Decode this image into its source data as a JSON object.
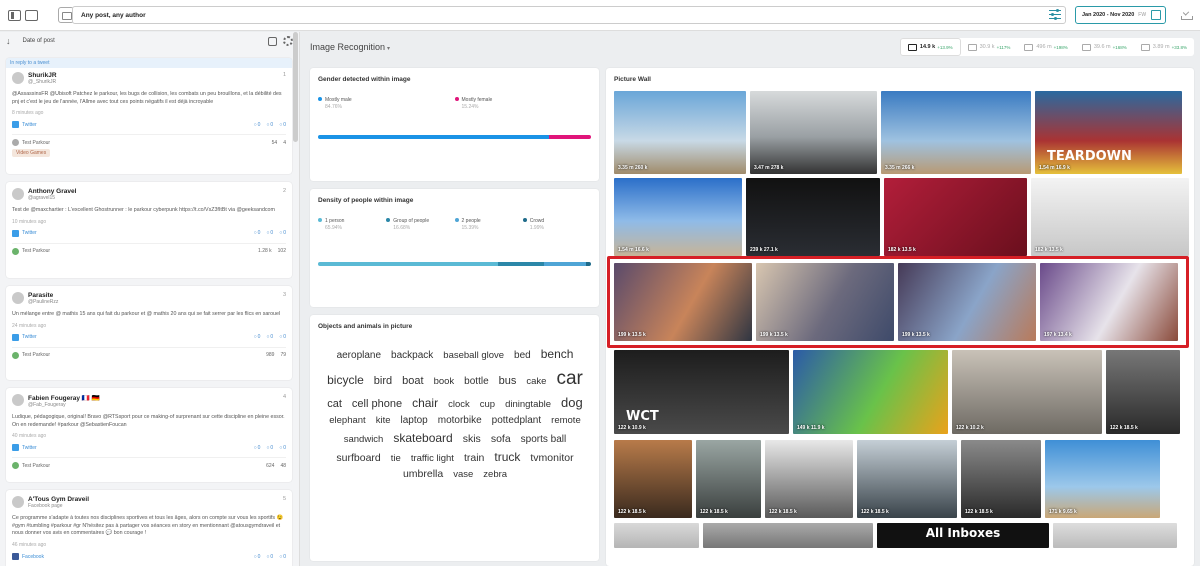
{
  "search": {
    "value": "Any post, any author"
  },
  "date_range": {
    "label": "Jan 2020 - Nov 2020",
    "hint": "FW"
  },
  "sidebar": {
    "sort_label": "Date of post"
  },
  "posts": [
    {
      "reply_note": "In reply to a tweet",
      "name": "ShurikJR",
      "handle": "@_ShurikJR",
      "num": "1",
      "text": "@AssassinsFR @Ubisoft Patchez le parkour, les bugs de collision, les combats un peu brouillons, et la débilité des pnj et c'est le jeu de l'année, l'Allme avec tout ces points négatifs il est déjà incroyable",
      "time": "8 minutes ago",
      "network": "Twitter",
      "eng": [
        "0",
        "0",
        "0"
      ],
      "project": "Test Parkour",
      "shares": "54",
      "reach": "4",
      "tag": "Video Games"
    },
    {
      "name": "Anthony Gravel",
      "handle": "@agravel15",
      "num": "2",
      "text": "Test de @maxchartier : L'excellent Ghostrunner : le parkour cyberpunk https://t.co/VsZ3fItBt via @geeksandcom",
      "time": "10 minutes ago",
      "network": "Twitter",
      "eng": [
        "0",
        "0",
        "0"
      ],
      "project": "Test Parkour",
      "shares": "1.28 k",
      "reach": "102"
    },
    {
      "name": "Parasite",
      "handle": "@PaulineRzz",
      "num": "3",
      "text": "Un mélange entre @ mathis 15 ans qui fait du parkour et @ mathis 20 ans qui se fait serrer par les flics en sarouel",
      "time": "24 minutes ago",
      "network": "Twitter",
      "eng": [
        "0",
        "0",
        "0"
      ],
      "project": "Test Parkour",
      "shares": "989",
      "reach": "79"
    },
    {
      "name": "Fabien Fougeray 🇫🇷 🇩🇪",
      "handle": "@Fab_Fougeray",
      "num": "4",
      "text": "Ludique, pédagogique, original! Bravo @RTSsport pour ce making-of surprenant sur cette discipline en pleine essor. On en redemande! #parkour @SebastienFoucan",
      "time": "40 minutes ago",
      "network": "Twitter",
      "eng": [
        "0",
        "0",
        "0"
      ],
      "project": "Test Parkour",
      "shares": "624",
      "reach": "48"
    },
    {
      "name": "A'Tous Gym Draveil",
      "handle": "Facebook page",
      "num": "5",
      "text": "Ce programme s'adapte à toutes nos disciplines sportives et tous les âges, alors on compte sur vous les sportifs 😉 #gym #tumbling #parkour #gr N'hésitez pas à partager vos séances en story en mentionnant @atousgymdraveil et nous donner vos avis en commentaires 💬 bon courage !",
      "time": "46 minutes ago",
      "network": "Facebook",
      "eng": [
        "0",
        "0",
        "0"
      ]
    }
  ],
  "main": {
    "title": "Image Recognition"
  },
  "metrics": [
    {
      "value": "14.9 k",
      "trend": "+13.9%",
      "icon": "comment-icon"
    },
    {
      "value": "30.9 k",
      "trend": "+117%",
      "icon": "screen-icon"
    },
    {
      "value": "496 m",
      "trend": "+198%",
      "icon": "link-icon"
    },
    {
      "value": "39.6 m",
      "trend": "+168%",
      "icon": "user-icon"
    },
    {
      "value": "3.89 m",
      "trend": "+33.8%",
      "icon": "share-icon"
    }
  ],
  "gender": {
    "title": "Gender detected within image",
    "items": [
      {
        "label": "Mostly male",
        "pct": "84.76%",
        "value": 84.76,
        "color": "#1a93e6"
      },
      {
        "label": "Mostly female",
        "pct": "15.24%",
        "value": 15.24,
        "color": "#e0157a"
      }
    ]
  },
  "density": {
    "title": "Density of people within image",
    "items": [
      {
        "label": "1 person",
        "pct": "65.94%",
        "value": 65.94,
        "color": "#5bbad5"
      },
      {
        "label": "Group of people",
        "pct": "16.68%",
        "value": 16.68,
        "color": "#2b87a8"
      },
      {
        "label": "2 people",
        "pct": "15.39%",
        "value": 15.39,
        "color": "#4fa5d6"
      },
      {
        "label": "Crowd",
        "pct": "1.99%",
        "value": 1.99,
        "color": "#1f6b8a"
      }
    ]
  },
  "objects": {
    "title": "Objects and animals in picture",
    "words": [
      {
        "t": "aeroplane",
        "s": 10
      },
      {
        "t": "backpack",
        "s": 10
      },
      {
        "t": "baseball glove",
        "s": 9.5
      },
      {
        "t": "bed",
        "s": 10
      },
      {
        "t": "bench",
        "s": 12
      },
      {
        "t": "bicycle",
        "s": 12
      },
      {
        "t": "bird",
        "s": 11
      },
      {
        "t": "boat",
        "s": 11
      },
      {
        "t": "book",
        "s": 9.5
      },
      {
        "t": "bottle",
        "s": 10
      },
      {
        "t": "bus",
        "s": 11
      },
      {
        "t": "cake",
        "s": 9.5
      },
      {
        "t": "car",
        "s": 19
      },
      {
        "t": "cat",
        "s": 11
      },
      {
        "t": "cell phone",
        "s": 11
      },
      {
        "t": "chair",
        "s": 12
      },
      {
        "t": "clock",
        "s": 9.5
      },
      {
        "t": "cup",
        "s": 9.5
      },
      {
        "t": "diningtable",
        "s": 9.5
      },
      {
        "t": "dog",
        "s": 13
      },
      {
        "t": "elephant",
        "s": 9.5
      },
      {
        "t": "kite",
        "s": 9.5
      },
      {
        "t": "laptop",
        "s": 10
      },
      {
        "t": "motorbike",
        "s": 10
      },
      {
        "t": "pottedplant",
        "s": 10
      },
      {
        "t": "remote",
        "s": 9.5
      },
      {
        "t": "sandwich",
        "s": 9.5
      },
      {
        "t": "skateboard",
        "s": 12
      },
      {
        "t": "skis",
        "s": 10.5
      },
      {
        "t": "sofa",
        "s": 10.5
      },
      {
        "t": "sports ball",
        "s": 10
      },
      {
        "t": "surfboard",
        "s": 10.5
      },
      {
        "t": "tie",
        "s": 9.5
      },
      {
        "t": "traffic light",
        "s": 9.5
      },
      {
        "t": "train",
        "s": 10.5
      },
      {
        "t": "truck",
        "s": 12
      },
      {
        "t": "tvmonitor",
        "s": 10.5
      },
      {
        "t": "umbrella",
        "s": 10.5
      },
      {
        "t": "vase",
        "s": 9.5
      },
      {
        "t": "zebra",
        "s": 9.5
      }
    ]
  },
  "wall": {
    "title": "Picture Wall",
    "rows": [
      [
        {
          "a": "3.35 m",
          "b": "260 k",
          "bg": "linear-gradient(#6aa6d8,#c8d9e6 60%,#a08b6a)"
        },
        {
          "a": "3.47 m",
          "b": "278 k",
          "bg": "linear-gradient(#d7dadb,#9aa0a4 55%,#333)"
        },
        {
          "a": "3.35 m",
          "b": "266 k",
          "bg": "linear-gradient(#3a7bc2,#9fc2e0 60%,#b89a74)"
        },
        {
          "a": "1.54 m",
          "b": "16.9 k",
          "bg": "linear-gradient(#2a6aa0,#a33 60%,#e5c03b)",
          "cap": "TEARDOWN"
        }
      ],
      [
        {
          "a": "1.54 m",
          "b": "16.6 k",
          "bg": "linear-gradient(#2b6fc9,#8fbbe8 55%,#c7b497)"
        },
        {
          "a": "239 k",
          "b": "27.1 k",
          "bg": "linear-gradient(#111,#2a2d33)"
        },
        {
          "a": "182 k",
          "b": "13.5 k",
          "bg": "linear-gradient(135deg,#b21e3a,#6a0f1d)"
        },
        {
          "a": "182 k",
          "b": "13.5 k",
          "bg": "linear-gradient(#f3f3f3,#c7c7c7)"
        }
      ],
      [
        {
          "a": "199 k",
          "b": "13.5 k",
          "bg": "linear-gradient(120deg,#5a4a6b,#c8845a 55%,#2f3542)"
        },
        {
          "a": "199 k",
          "b": "13.5 k",
          "bg": "linear-gradient(120deg,#d8c6b0,#6c6a7d 55%,#3e4a6a)"
        },
        {
          "a": "199 k",
          "b": "13.5 k",
          "bg": "linear-gradient(120deg,#463a57,#8aa4c8 55%,#b97a5a)"
        },
        {
          "a": "197 k",
          "b": "13.4 k",
          "bg": "linear-gradient(120deg,#6a4a8a,#e7e3ea 55%,#8a4a3a)"
        }
      ],
      [
        {
          "a": "122 k",
          "b": "10.9 k",
          "bg": "linear-gradient(#1d1d1d,#4a4a4a)",
          "cap": "WCT"
        },
        {
          "a": "149 k",
          "b": "11.9 k",
          "bg": "linear-gradient(120deg,#2b5aa8,#69c24a 55%,#eaa21b)"
        },
        {
          "a": "122 k",
          "b": "10.2 k",
          "bg": "linear-gradient(#c9c2b8,#6e6a63)"
        },
        {
          "a": "122 k",
          "b": "18.5 k",
          "bg": "linear-gradient(#777,#2a2a2a)"
        }
      ],
      [
        {
          "a": "122 k",
          "b": "18.5 k",
          "bg": "linear-gradient(#b87b4a,#3a2a1e)"
        },
        {
          "a": "122 k",
          "b": "18.5 k",
          "bg": "linear-gradient(#9aa6a3,#3a3f3e)"
        },
        {
          "a": "122 k",
          "b": "18.5 k",
          "bg": "linear-gradient(#e8e8e8,#5a5a5a)"
        },
        {
          "a": "122 k",
          "b": "18.5 k",
          "bg": "linear-gradient(#c5cfd6,#39434a)"
        },
        {
          "a": "122 k",
          "b": "18.5 k",
          "bg": "linear-gradient(#8a8a8a,#2a2a2a)"
        },
        {
          "a": "171 k",
          "b": "9.65 k",
          "bg": "linear-gradient(#3f8fd6,#9cc8ea 60%,#c9a777)"
        }
      ],
      [
        {
          "a": "",
          "b": "",
          "bg": "linear-gradient(#d9d9d9,#b5b5b5)"
        },
        {
          "a": "",
          "b": "",
          "bg": "linear-gradient(#aaa,#777)"
        },
        {
          "a": "",
          "b": "",
          "bg": "#111",
          "cap": "All Inboxes"
        },
        {
          "a": "",
          "b": "",
          "bg": "linear-gradient(#ddd,#bbb)"
        }
      ]
    ]
  }
}
